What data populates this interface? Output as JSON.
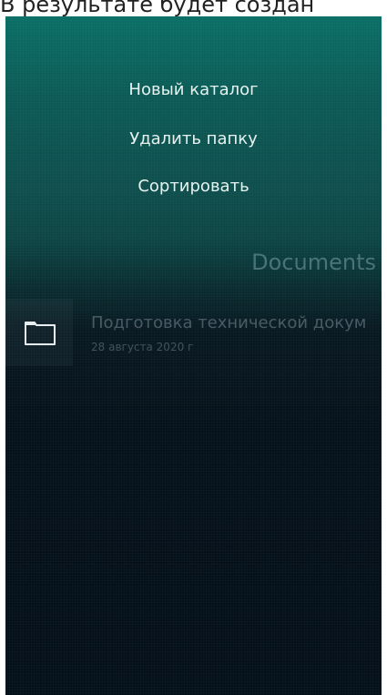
{
  "caption": "В результате будет создан",
  "menu": {
    "items": [
      {
        "label": "Новый каталог"
      },
      {
        "label": "Удалить папку"
      },
      {
        "label": "Сортировать"
      }
    ]
  },
  "page": {
    "title": "Documents"
  },
  "folders": [
    {
      "name": "Подготовка технической докум",
      "date": "28 августа 2020 г",
      "icon": "folder-icon"
    }
  ],
  "colors": {
    "accent_top": "#0a6f66",
    "background_bottom": "#04101a",
    "menu_text": "#e6f2f0"
  }
}
